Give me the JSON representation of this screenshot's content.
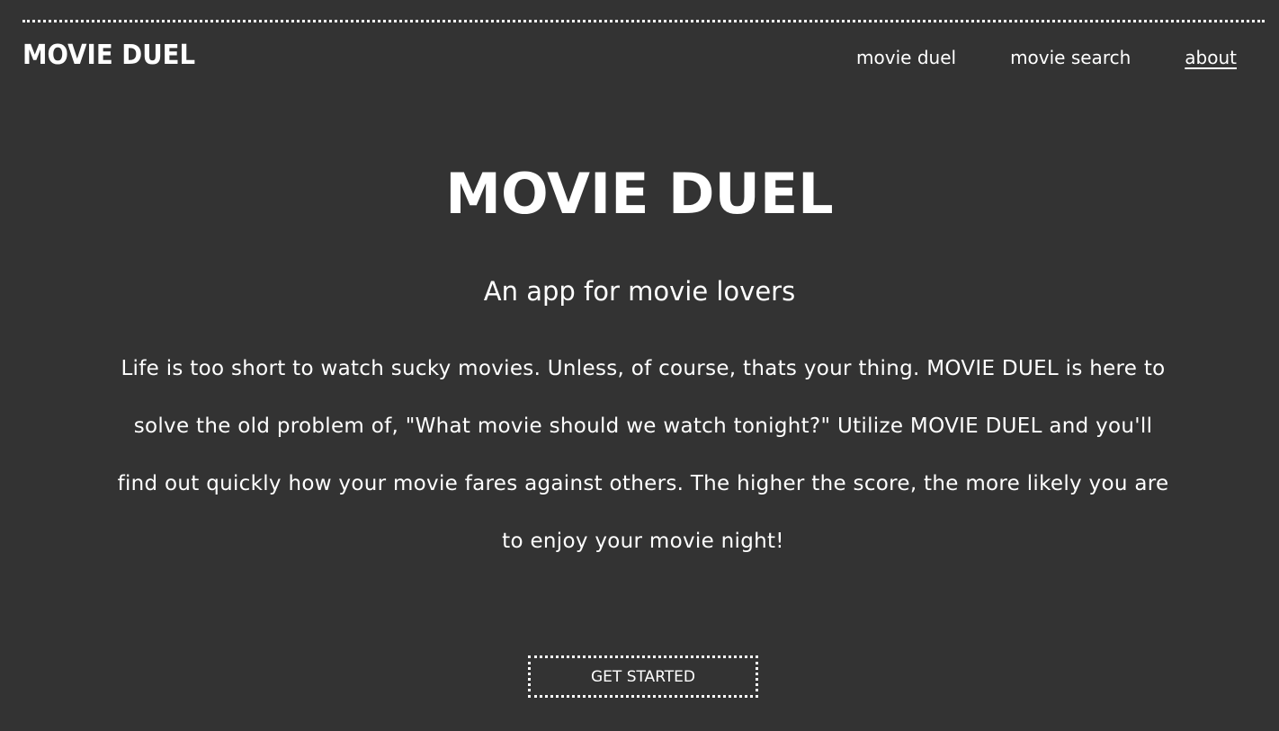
{
  "header": {
    "brand": "MOVIE DUEL",
    "nav": [
      {
        "label": "movie duel",
        "active": false
      },
      {
        "label": "movie search",
        "active": false
      },
      {
        "label": "about",
        "active": true
      }
    ]
  },
  "hero": {
    "title": "MOVIE DUEL",
    "subtitle": "An app for movie lovers",
    "body": "Life is too short to watch sucky movies. Unless, of course, thats your thing. MOVIE DUEL is here to solve the old problem of, \"What movie should we watch tonight?\" Utilize MOVIE DUEL and you'll find out quickly how your movie fares against others. The higher the score, the more likely you are to enjoy your movie night!",
    "cta_label": "GET STARTED"
  },
  "colors": {
    "background": "#333333",
    "foreground": "#ffffff"
  }
}
